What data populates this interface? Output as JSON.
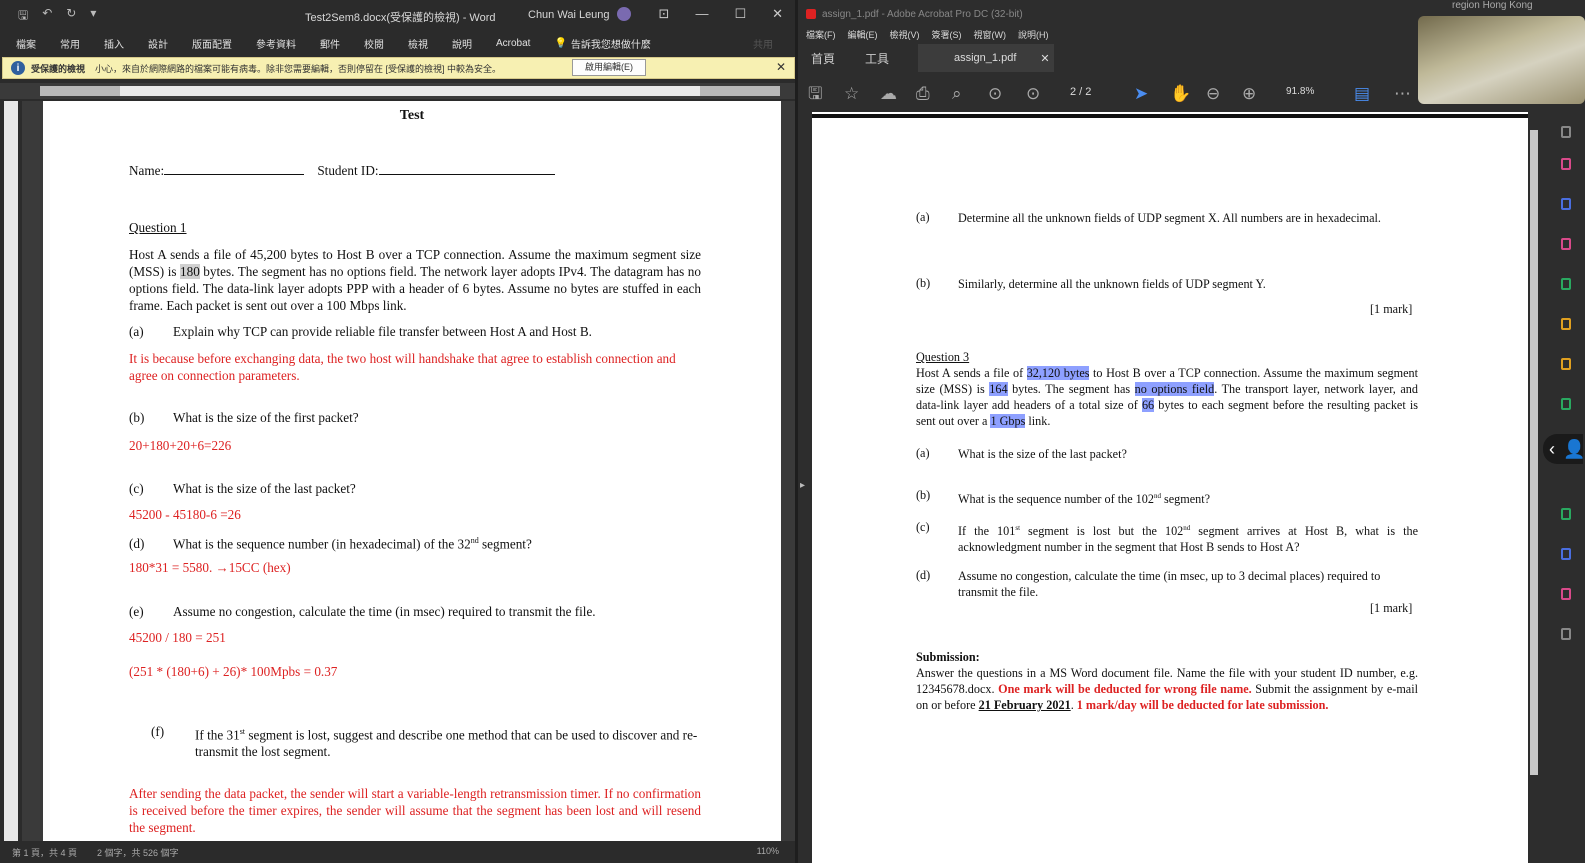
{
  "word": {
    "doc_title": "Test2Sem8.docx(受保護的檢視) - Word",
    "user": "Chun Wai Leung",
    "ribbon_tabs": [
      "檔案",
      "常用",
      "插入",
      "設計",
      "版面配置",
      "參考資料",
      "郵件",
      "校閱",
      "檢視",
      "說明",
      "Acrobat"
    ],
    "tell_me": "告訴我您想做什麼",
    "share": "共用",
    "protected": {
      "title": "受保護的檢視",
      "message": "小心，來自於網際網路的檔案可能有病毒。除非您需要編輯，否則停留在 [受保護的檢視] 中較為安全。",
      "enable_button": "啟用編輯(E)"
    },
    "page": {
      "title": "Test",
      "name_label": "Name:",
      "student_label": "Student ID:",
      "q1_title": "Question 1",
      "q1_body_a": "Host A sends a file of 45,200 bytes to Host B over a TCP connection. Assume the maximum segment size (MSS) is ",
      "q1_body_hl": "180",
      "q1_body_b": " bytes. The segment has no options field. The network layer adopts IPv4. The datagram has no options field. The data-link layer adopts PPP with a header of 6 bytes. Assume no bytes are stuffed in each frame. Each packet is sent out over a 100 Mbps link.",
      "a_label": "(a)",
      "a_text": "Explain why TCP can provide reliable file transfer between Host A and Host B.",
      "a_answer": "It is because before exchanging data, the two host will handshake that agree to establish connection and agree on connection parameters.",
      "b_label": "(b)",
      "b_text": "What is the size of the first packet?",
      "b_answer": "20+180+20+6=226",
      "c_label": "(c)",
      "c_text": "What is the size of the last packet?",
      "c_answer": "45200 - 45180-6 =26",
      "d_label": "(d)",
      "d_text_a": "What is the sequence number (in hexadecimal) of the 32",
      "d_sup": "nd",
      "d_text_b": " segment?",
      "d_answer": "180*31 = 5580. →15CC (hex)",
      "e_label": "(e)",
      "e_text": "Assume no congestion, calculate the time (in msec) required to transmit the file.",
      "e_answer1": "45200 / 180 = 251",
      "e_answer2": "(251 * (180+6) + 26)* 100Mpbs =  0.37",
      "f_label": "(f)",
      "f_text_a": "If the 31",
      "f_sup": "st",
      "f_text_b": " segment is lost, suggest and describe one method that can be used to discover and re-transmit the lost segment.",
      "f_answer": "After sending the data packet, the sender will start a variable-length retransmission timer. If no confirmation is received before the timer expires, the sender will assume that the segment has been lost and will resend the segment."
    },
    "status": {
      "pages": "第 1 頁，共 4 頁",
      "words": "2 個字，共 526 個字",
      "zoom": "110%"
    }
  },
  "acrobat": {
    "title": "assign_1.pdf - Adobe Acrobat Pro DC (32-bit)",
    "menu": [
      "檔案(F)",
      "編輯(E)",
      "檢視(V)",
      "簽署(S)",
      "視窗(W)",
      "說明(H)"
    ],
    "tab_home": "首頁",
    "tab_tools": "工具",
    "tab_file": "assign_1.pdf",
    "page_indicator": "2 / 2",
    "zoom": "91.8%",
    "doc": {
      "a_label": "(a)",
      "a_text": "Determine all the unknown fields of UDP segment X. All numbers are in hexadecimal.",
      "b_label": "(b)",
      "b_text": "Similarly, determine all the unknown fields of UDP segment Y.",
      "mark1": "[1 mark]",
      "q3_title": "Question 3",
      "q3_p1": "Host A sends a file of ",
      "q3_h1": "32,120 bytes",
      "q3_p2": " to Host B over a TCP connection. Assume the maximum segment size (MSS) is ",
      "q3_h2": "164",
      "q3_p3": " bytes. The segment has ",
      "q3_h3": "no options field",
      "q3_p4": ". The transport layer, network layer, and data-link layer add headers of a total size of ",
      "q3_h4": "66",
      "q3_p5": " bytes to each segment before the resulting packet is sent out over a ",
      "q3_h5": "1 Gbps",
      "q3_p6": " link.",
      "qa_label": "(a)",
      "qa_text": "What is the size of the last packet?",
      "qb_label": "(b)",
      "qb_text_a": "What is the sequence number of the 102",
      "qb_sup": "nd",
      "qb_text_b": " segment?",
      "qc_label": "(c)",
      "qc_text_a": "If the 101",
      "qc_sup1": "st",
      "qc_text_b": " segment is lost but the 102",
      "qc_sup2": "nd",
      "qc_text_c": " segment arrives at Host B, what is the acknowledgment number in the segment that Host B sends to Host A?",
      "qd_label": "(d)",
      "qd_text": "Assume no congestion, calculate the time (in msec, up to 3 decimal places) required to transmit the file.",
      "mark2": "[1 mark]",
      "sub_title": "Submission:",
      "sub_text1": "Answer the questions in a MS Word document file. Name the file with your student ID number, e.g. 12345678.docx. ",
      "sub_red1": "One mark will be deducted for wrong file name.",
      "sub_text2": " Submit the assignment by e-mail on or before ",
      "sub_date": "21 February 2021",
      "sub_text3": ". ",
      "sub_red2": "1 mark/day will be deducted for late submission."
    }
  },
  "overlay": {
    "region": "region    Hong Kong"
  }
}
